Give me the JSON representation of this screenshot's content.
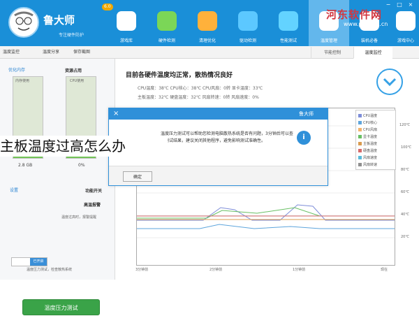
{
  "app": {
    "title": "鲁大师",
    "subtitle": "专注硬件防护",
    "badge": "6.0",
    "watermark": "河东软件网",
    "watermark_url": "www.pc0359.cn"
  },
  "nav": [
    {
      "label": "游戏库",
      "icon": "game-controller-icon",
      "color": "#ffffff"
    },
    {
      "label": "硬件检测",
      "icon": "kite-icon",
      "color": "#7bd657"
    },
    {
      "label": "清理优化",
      "icon": "broom-icon",
      "color": "#ffb13b"
    },
    {
      "label": "驱动检测",
      "icon": "gear-icon",
      "color": "#5cc8ff"
    },
    {
      "label": "性能测试",
      "icon": "speedometer-icon",
      "color": "#63d3ff"
    },
    {
      "label": "温度管理",
      "icon": "thermometer-icon",
      "color": "#ffffff",
      "active": true
    },
    {
      "label": "装机必备",
      "icon": "box-icon",
      "color": "#ffffff"
    },
    {
      "label": "游戏中心",
      "icon": "home-icon",
      "color": "#ffffff"
    }
  ],
  "toolbar": {
    "left_buttons": [
      "温度监控",
      "温度分享",
      "保存截图"
    ],
    "tabs": [
      "节能控制",
      "温度监控"
    ]
  },
  "sidebar": {
    "resource_title": "资源占用",
    "optimize_link": "优化内存",
    "cpu_label": "CPU使用",
    "memory_label": "内存使用",
    "cpu_value": "0%",
    "memory_value": "2.8 GB",
    "cpu_fill_fraction": 0.03,
    "memory_fill_fraction": 0.25,
    "switch_title": "功能开关",
    "settings_link": "设置",
    "high_temp_label": "高温报警",
    "toggle_state": "已开启",
    "toggle_desc": "温度过高时，报警提醒",
    "stress_button": "温度压力测试",
    "stress_desc": "温度压力测试，检查散热系统"
  },
  "main": {
    "status_title": "目前各硬件温度均正常，散热情况良好",
    "info_line1": "CPU温度：38℃    CPU核心：38℃    CPU风扇：0转    显卡温度：33℃",
    "info_line2": "主板温度：32℃    硬盘温度：32℃    风扇转速：0转    风扇速度：0%",
    "y_axis": [
      "120℃",
      "100℃",
      "80℃",
      "60℃",
      "40℃",
      "20℃"
    ],
    "x_axis": [
      "3分钟前",
      "2分钟前",
      "1分钟前",
      "现在"
    ],
    "legend": [
      {
        "label": "CPU温度",
        "color": "#7d8dd8"
      },
      {
        "label": "CPU核心",
        "color": "#5ea5dc"
      },
      {
        "label": "CPU风扇",
        "color": "#f2b36d"
      },
      {
        "label": "显卡温度",
        "color": "#68bf63"
      },
      {
        "label": "主板温度",
        "color": "#d99b4f"
      },
      {
        "label": "硬盘温度",
        "color": "#d56a6a"
      },
      {
        "label": "风扇速度",
        "color": "#59b9d9"
      },
      {
        "label": "风扇转速",
        "color": "#8f8f8f"
      }
    ]
  },
  "dialog": {
    "title": "鲁大师",
    "message": "温度压力测试可以帮助您检测电脑散热系统是否有问题，3分钟后可以查看测试结果，建议关闭其他程序，避免影响测试准确性。",
    "button": "确定"
  },
  "caption": "主板温度过高怎么办"
}
